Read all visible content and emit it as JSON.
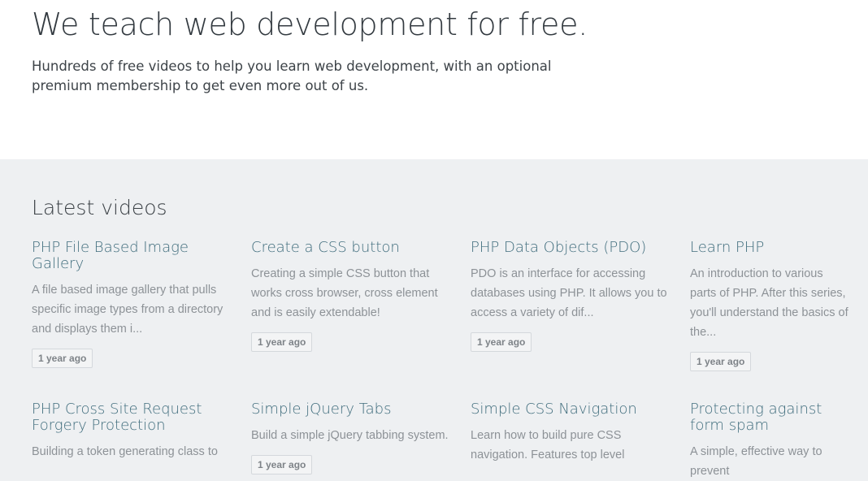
{
  "hero": {
    "title": "We teach web development for free.",
    "subtitle": "Hundreds of free videos to help you learn web development, with an optional premium membership to get even more out of us."
  },
  "latest": {
    "heading": "Latest videos",
    "videos": [
      {
        "title": "PHP File Based Image Gallery",
        "description": "A file based image gallery that pulls specific image types from a directory and displays them i...",
        "age": "1 year ago"
      },
      {
        "title": "Create a CSS button",
        "description": "Creating a simple CSS button that works cross browser, cross element and is easily extendable!",
        "age": "1 year ago"
      },
      {
        "title": "PHP Data Objects (PDO)",
        "description": "PDO is an interface for accessing databases using PHP. It allows you to access a variety of dif...",
        "age": "1 year ago"
      },
      {
        "title": "Learn PHP",
        "description": "An introduction to various parts of PHP. After this series, you'll understand the basics of the...",
        "age": "1 year ago"
      },
      {
        "title": "PHP Cross Site Request Forgery Protection",
        "description": "Building a token generating class to",
        "age": ""
      },
      {
        "title": "Simple jQuery Tabs",
        "description": "Build a simple jQuery tabbing system.",
        "age": "1 year ago"
      },
      {
        "title": "Simple CSS Navigation",
        "description": "Learn how to build pure CSS navigation. Features top level",
        "age": ""
      },
      {
        "title": "Protecting against form spam",
        "description": "A simple, effective way to prevent",
        "age": ""
      }
    ]
  }
}
